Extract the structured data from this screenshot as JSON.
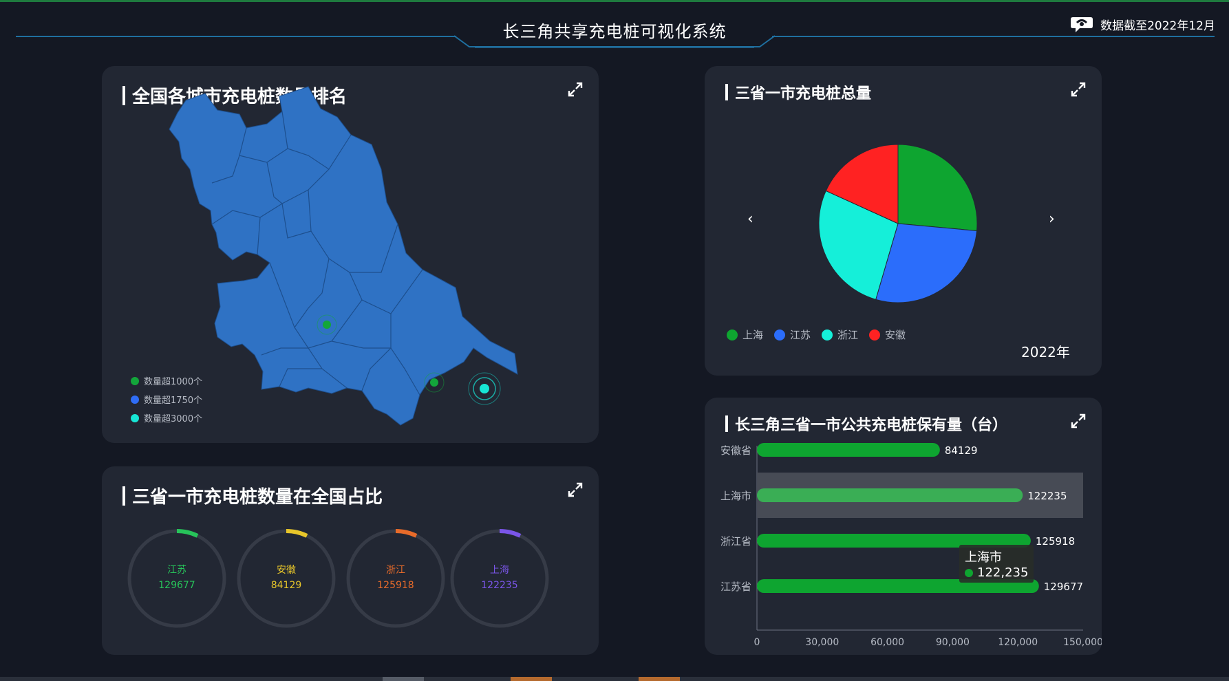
{
  "header": {
    "title": "长三角共享充电桩可视化系统",
    "date_label": "数据截至2022年12月",
    "date_icon": "chat-icon"
  },
  "map_panel": {
    "title": "全国各城市充电桩数量排名",
    "legend": [
      {
        "label": "数量超1000个",
        "color": "#13a63b"
      },
      {
        "label": "数量超1750个",
        "color": "#2f6df6"
      },
      {
        "label": "数量超3000个",
        "color": "#17e6d6"
      }
    ],
    "map_color": "#2f72c4"
  },
  "pie_panel": {
    "title": "三省一市充电桩总量",
    "year": "2022年",
    "prev_label": "‹",
    "next_label": "›",
    "legend": [
      {
        "label": "上海",
        "color": "#0ea530"
      },
      {
        "label": "江苏",
        "color": "#2b6dfb"
      },
      {
        "label": "浙江",
        "color": "#15efd9"
      },
      {
        "label": "安徽",
        "color": "#ff2222"
      }
    ]
  },
  "ring_panel": {
    "title": "三省一市充电桩数量在全国占比",
    "rings": [
      {
        "name": "江苏",
        "value": "129677",
        "color": "#27c35a"
      },
      {
        "name": "安徽",
        "value": "84129",
        "color": "#e8c62a"
      },
      {
        "name": "浙江",
        "value": "125918",
        "color": "#e86b2a"
      },
      {
        "name": "上海",
        "value": "122235",
        "color": "#7a55e8"
      }
    ]
  },
  "bar_panel": {
    "title": "长三角三省一市公共充电桩保有量（台）",
    "tooltip": {
      "name": "上海市",
      "value": "122,235"
    }
  },
  "chart_data": [
    {
      "type": "pie",
      "title": "三省一市充电桩总量",
      "labels": [
        "上海",
        "江苏",
        "浙江",
        "安徽"
      ],
      "values": [
        122235,
        129677,
        125918,
        84129
      ],
      "colors": [
        "#0ea530",
        "#2b6dfb",
        "#15efd9",
        "#ff2222"
      ],
      "legend": "bottom-left"
    },
    {
      "type": "bar",
      "orientation": "horizontal",
      "title": "长三角三省一市公共充电桩保有量（台）",
      "categories": [
        "安徽省",
        "上海市",
        "浙江省",
        "江苏省"
      ],
      "values": [
        84129,
        122235,
        125918,
        129677
      ],
      "value_labels": [
        "84129",
        "122235",
        "125918",
        "129677"
      ],
      "xlim": [
        0,
        150000
      ],
      "ticks": [
        "0",
        "30,000",
        "60,000",
        "90,000",
        "120,000",
        "150,000"
      ],
      "highlight": "上海市",
      "color": "#0ea530",
      "highlight_color": "#3aae55"
    }
  ]
}
